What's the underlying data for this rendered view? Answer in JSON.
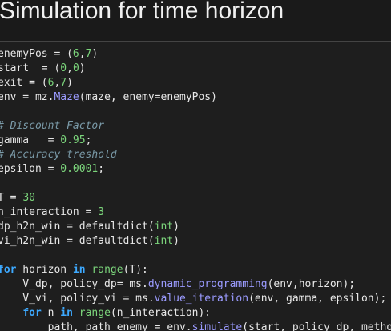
{
  "heading": {
    "title": "Simulation for time horizon"
  },
  "colors": {
    "background": "#1e1e1e",
    "text": "#e8e8e8",
    "keyword": "#3da9ff",
    "number": "#7cd67c",
    "function": "#9b9bff",
    "comment": "#7a9aa8"
  },
  "code": {
    "lines": [
      [
        {
          "t": "enemyPos = (",
          "c": ""
        },
        {
          "t": "6",
          "c": "num"
        },
        {
          "t": ",",
          "c": ""
        },
        {
          "t": "7",
          "c": "num"
        },
        {
          "t": ")",
          "c": ""
        }
      ],
      [
        {
          "t": "start  = (",
          "c": ""
        },
        {
          "t": "0",
          "c": "num"
        },
        {
          "t": ",",
          "c": ""
        },
        {
          "t": "0",
          "c": "num"
        },
        {
          "t": ")",
          "c": ""
        }
      ],
      [
        {
          "t": "exit = (",
          "c": ""
        },
        {
          "t": "6",
          "c": "num"
        },
        {
          "t": ",",
          "c": ""
        },
        {
          "t": "7",
          "c": "num"
        },
        {
          "t": ")",
          "c": ""
        }
      ],
      [
        {
          "t": "env = mz.",
          "c": ""
        },
        {
          "t": "Maze",
          "c": "fn"
        },
        {
          "t": "(maze, enemy=enemyPos)",
          "c": ""
        }
      ],
      [],
      [
        {
          "t": "# Discount Factor",
          "c": "cm"
        }
      ],
      [
        {
          "t": "gamma   = ",
          "c": ""
        },
        {
          "t": "0.95",
          "c": "num"
        },
        {
          "t": ";",
          "c": ""
        }
      ],
      [
        {
          "t": "# Accuracy treshold",
          "c": "cm"
        }
      ],
      [
        {
          "t": "epsilon = ",
          "c": ""
        },
        {
          "t": "0.0001",
          "c": "num"
        },
        {
          "t": ";",
          "c": ""
        }
      ],
      [],
      [
        {
          "t": "T = ",
          "c": ""
        },
        {
          "t": "30",
          "c": "num"
        }
      ],
      [
        {
          "t": "n_interaction = ",
          "c": ""
        },
        {
          "t": "3",
          "c": "num"
        }
      ],
      [
        {
          "t": "dp_h2n_win = defaultdict(",
          "c": ""
        },
        {
          "t": "int",
          "c": "bi"
        },
        {
          "t": ")",
          "c": ""
        }
      ],
      [
        {
          "t": "vi_h2n_win = defaultdict(",
          "c": ""
        },
        {
          "t": "int",
          "c": "bi"
        },
        {
          "t": ")",
          "c": ""
        }
      ],
      [],
      [
        {
          "t": "for",
          "c": "kw"
        },
        {
          "t": " horizon ",
          "c": ""
        },
        {
          "t": "in",
          "c": "kw"
        },
        {
          "t": " ",
          "c": ""
        },
        {
          "t": "range",
          "c": "bi"
        },
        {
          "t": "(T):",
          "c": ""
        }
      ],
      [
        {
          "t": "    V_dp, policy_dp= ms.",
          "c": ""
        },
        {
          "t": "dynamic_programming",
          "c": "fn"
        },
        {
          "t": "(env,horizon);",
          "c": ""
        }
      ],
      [
        {
          "t": "    V_vi, policy_vi = ms.",
          "c": ""
        },
        {
          "t": "value_iteration",
          "c": "fn"
        },
        {
          "t": "(env, gamma, epsilon);",
          "c": ""
        }
      ],
      [
        {
          "t": "    ",
          "c": ""
        },
        {
          "t": "for",
          "c": "kw"
        },
        {
          "t": " n ",
          "c": ""
        },
        {
          "t": "in",
          "c": "kw"
        },
        {
          "t": " ",
          "c": ""
        },
        {
          "t": "range",
          "c": "bi"
        },
        {
          "t": "(n_interaction):",
          "c": ""
        }
      ],
      [
        {
          "t": "        path, path_enemy = env.",
          "c": ""
        },
        {
          "t": "simulate",
          "c": "fn"
        },
        {
          "t": "(start, policy_dp, method);",
          "c": ""
        }
      ]
    ]
  }
}
